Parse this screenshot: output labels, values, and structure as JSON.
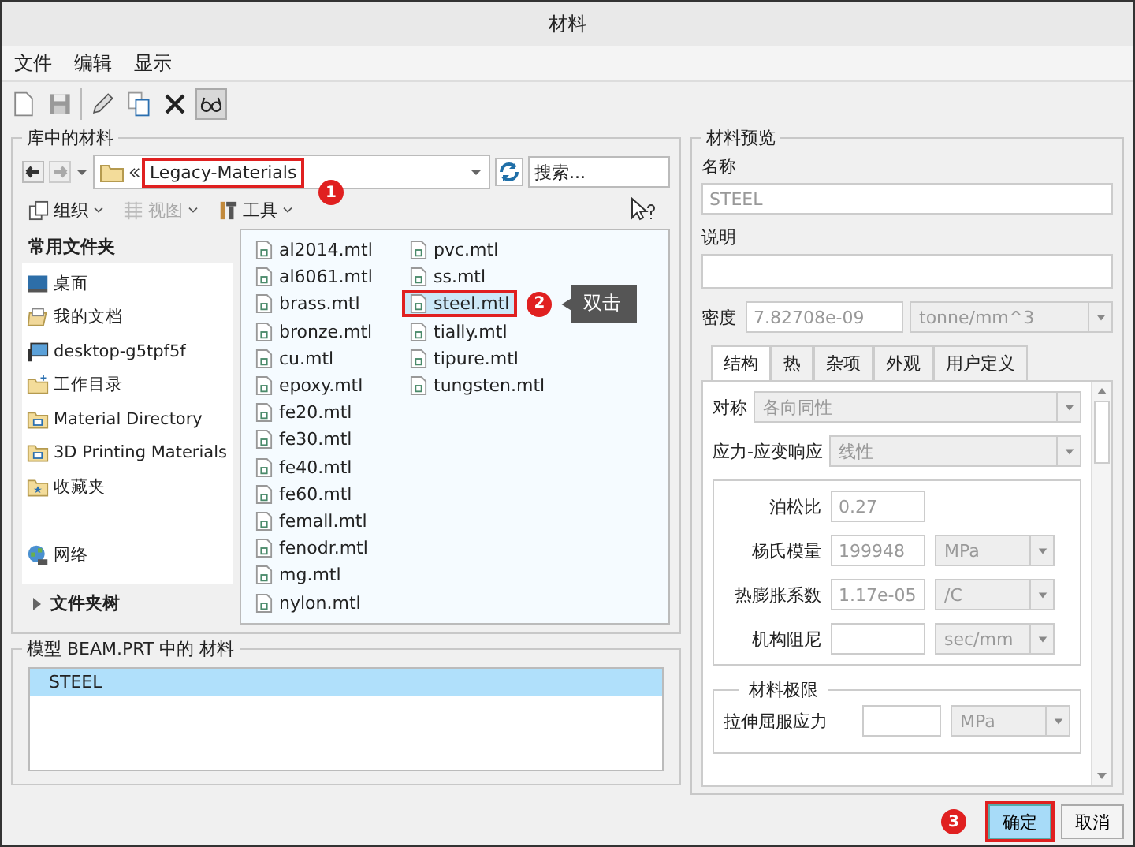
{
  "window": {
    "title": "材料"
  },
  "menu": [
    "文件",
    "编辑",
    "显示"
  ],
  "toolbar": {
    "preview_on": true
  },
  "library": {
    "title": "库中的材料",
    "path": "Legacy-Materials",
    "path_callout": "1",
    "search_placeholder": "搜索...",
    "actions": [
      {
        "label": "组织",
        "kind": "organize",
        "disabled": false
      },
      {
        "label": "视图",
        "kind": "view",
        "disabled": true
      },
      {
        "label": "工具",
        "kind": "tools",
        "disabled": false
      }
    ],
    "favorites_title": "常用文件夹",
    "favorites": [
      {
        "label": "桌面",
        "kind": "desktop"
      },
      {
        "label": "我的文档",
        "kind": "documents"
      },
      {
        "label": "desktop-g5tpf5f",
        "kind": "computer"
      },
      {
        "label": "工作目录",
        "kind": "workdir"
      },
      {
        "label": "Material Directory",
        "kind": "folder"
      },
      {
        "label": "3D Printing Materials",
        "kind": "folder"
      },
      {
        "label": "收藏夹",
        "kind": "favorites"
      },
      {
        "label": "网络",
        "kind": "network"
      }
    ],
    "tree_label": "文件夹树",
    "files": [
      {
        "name": "al2014.mtl",
        "selected": false
      },
      {
        "name": "al6061.mtl",
        "selected": false
      },
      {
        "name": "brass.mtl",
        "selected": false
      },
      {
        "name": "bronze.mtl",
        "selected": false
      },
      {
        "name": "cu.mtl",
        "selected": false
      },
      {
        "name": "epoxy.mtl",
        "selected": false
      },
      {
        "name": "fe20.mtl",
        "selected": false
      },
      {
        "name": "fe30.mtl",
        "selected": false
      },
      {
        "name": "fe40.mtl",
        "selected": false
      },
      {
        "name": "fe60.mtl",
        "selected": false
      },
      {
        "name": "femall.mtl",
        "selected": false
      },
      {
        "name": "fenodr.mtl",
        "selected": false
      },
      {
        "name": "mg.mtl",
        "selected": false
      },
      {
        "name": "nylon.mtl",
        "selected": false
      },
      {
        "name": "pvc.mtl",
        "selected": false
      },
      {
        "name": "ss.mtl",
        "selected": false
      },
      {
        "name": "steel.mtl",
        "selected": true,
        "callout": "2",
        "note": "双击"
      },
      {
        "name": "tially.mtl",
        "selected": false
      },
      {
        "name": "tipure.mtl",
        "selected": false
      },
      {
        "name": "tungsten.mtl",
        "selected": false
      }
    ]
  },
  "model": {
    "title": "模型 BEAM.PRT 中的 材料",
    "items": [
      {
        "label": "STEEL",
        "selected": true
      }
    ]
  },
  "preview": {
    "title": "材料预览",
    "name_label": "名称",
    "name_value": "STEEL",
    "desc_label": "说明",
    "density_label": "密度",
    "density_value": "7.82708e-09",
    "density_unit": "tonne/mm^3",
    "tabs": [
      {
        "label": "结构",
        "selected": true
      },
      {
        "label": "热",
        "selected": false
      },
      {
        "label": "杂项",
        "selected": false
      },
      {
        "label": "外观",
        "selected": false
      },
      {
        "label": "用户定义",
        "selected": false
      }
    ],
    "symmetry_label": "对称",
    "symmetry_value": "各向同性",
    "response_label": "应力-应变响应",
    "response_value": "线性",
    "properties": [
      {
        "label": "泊松比",
        "value": "0.27"
      },
      {
        "label": "杨氏模量",
        "value": "199948",
        "unit": "MPa"
      },
      {
        "label": "热膨胀系数",
        "value": "1.17e-05",
        "unit": "/C"
      },
      {
        "label": "机构阻尼",
        "unit": "sec/mm"
      }
    ],
    "limits_title": "材料极限",
    "limits": [
      {
        "label": "拉伸屈服应力",
        "unit": "MPa"
      }
    ]
  },
  "buttons": [
    {
      "label": "确定",
      "kind": "ok",
      "callout": "3"
    },
    {
      "label": "取消",
      "kind": "cancel"
    }
  ]
}
